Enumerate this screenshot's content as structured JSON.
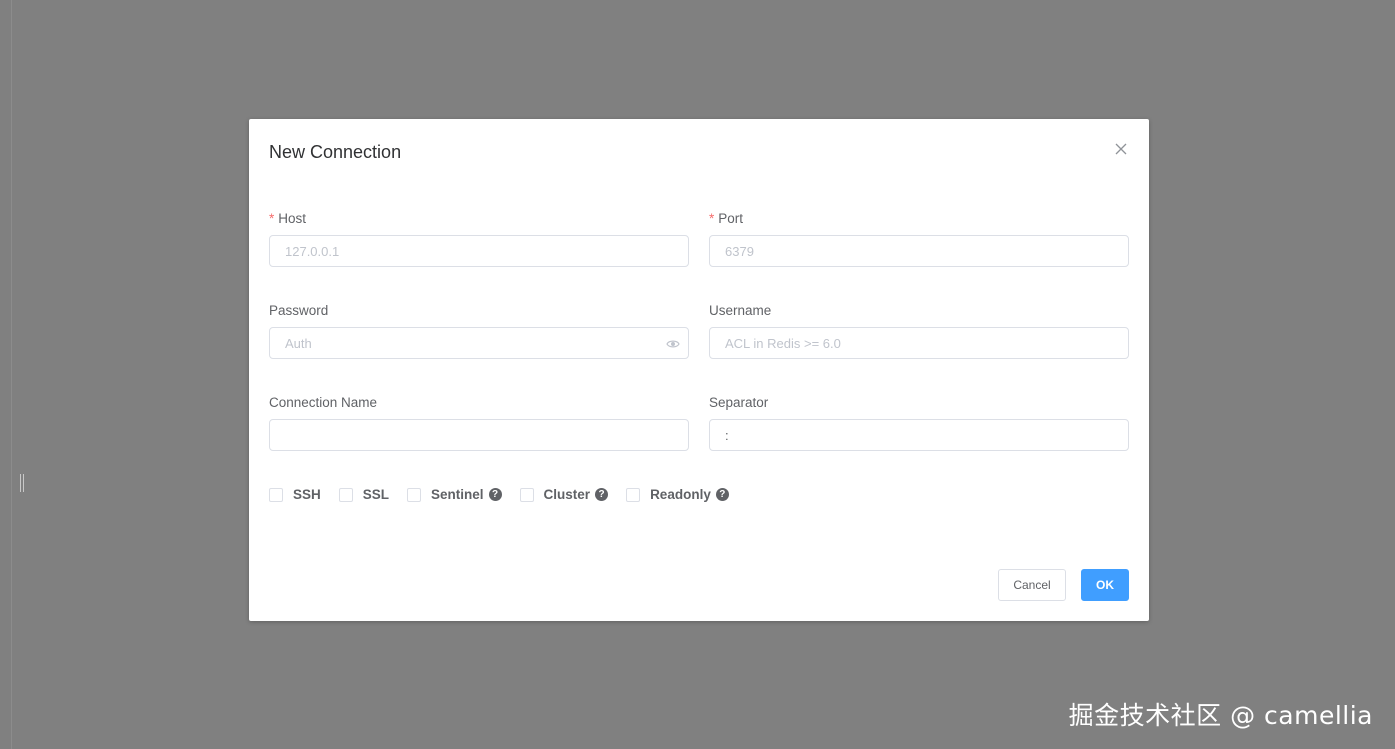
{
  "dialog": {
    "title": "New Connection",
    "close_icon": "close-icon"
  },
  "form": {
    "host": {
      "label": "Host",
      "required_mark": "*",
      "placeholder": "127.0.0.1",
      "value": ""
    },
    "port": {
      "label": "Port",
      "required_mark": "*",
      "placeholder": "6379",
      "value": ""
    },
    "password": {
      "label": "Password",
      "placeholder": "Auth",
      "value": "",
      "icon": "eye-icon"
    },
    "username": {
      "label": "Username",
      "placeholder": "ACL in Redis >= 6.0",
      "value": ""
    },
    "connection_name": {
      "label": "Connection Name",
      "placeholder": "",
      "value": ""
    },
    "separator": {
      "label": "Separator",
      "placeholder": "",
      "value": ":"
    }
  },
  "options": [
    {
      "label": "SSH",
      "help": false,
      "checked": false
    },
    {
      "label": "SSL",
      "help": false,
      "checked": false
    },
    {
      "label": "Sentinel",
      "help": true,
      "checked": false
    },
    {
      "label": "Cluster",
      "help": true,
      "checked": false
    },
    {
      "label": "Readonly",
      "help": true,
      "checked": false
    }
  ],
  "help_glyph": "?",
  "buttons": {
    "cancel": "Cancel",
    "ok": "OK"
  },
  "watermark": "掘金技术社区 @ camellia",
  "colors": {
    "primary": "#409eff",
    "required": "#f56c6c",
    "overlay": "#808080"
  }
}
